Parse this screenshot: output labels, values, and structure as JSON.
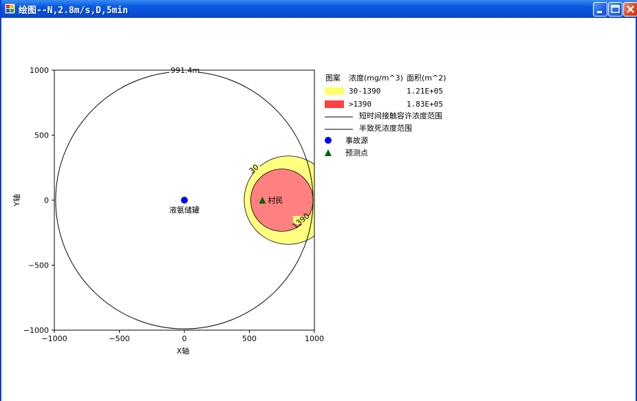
{
  "window": {
    "title": "绘图--N,2.8m/s,D,5min"
  },
  "legend": {
    "header": {
      "pattern": "图案",
      "concentration": "浓度(mg/m^3)",
      "area": "面积(m^2)"
    },
    "rows": [
      {
        "label": "30-1390",
        "area": "1.21E+05",
        "color": "#ffff66"
      },
      {
        "label": ">1390",
        "area": "1.83E+05",
        "color": "#ff4040"
      }
    ],
    "lines": [
      {
        "label": "短时间接触容许浓度范围"
      },
      {
        "label": "半致死浓度范围"
      }
    ],
    "markers": [
      {
        "label": "事故源",
        "color": "#0000ff",
        "shape": "circle"
      },
      {
        "label": "预测点",
        "color": "#006400",
        "shape": "triangle"
      }
    ]
  },
  "chart_data": {
    "type": "scatter",
    "xlabel": "X轴",
    "ylabel": "Y轴",
    "xlim": [
      -1000,
      1000
    ],
    "ylim": [
      -1000,
      1000
    ],
    "xticks": [
      -1000,
      -500,
      0,
      500,
      1000
    ],
    "yticks": [
      1000,
      500,
      0,
      -500,
      -1000
    ],
    "xtick_labels": [
      "−1000",
      "−500",
      "0",
      "500",
      "1000"
    ],
    "ytick_labels": [
      "1000",
      "500",
      "0",
      "−500",
      "−1000"
    ],
    "contours": [
      {
        "level": "30",
        "cx": 800,
        "cy": 0,
        "r": 340,
        "fill": "#ffff80"
      },
      {
        "level": "1390",
        "cx": 750,
        "cy": 0,
        "r": 240,
        "fill": "#ff8080"
      }
    ],
    "range_circle": {
      "cx": 0,
      "cy": 0,
      "r": 990,
      "label": "991.4m"
    },
    "points": [
      {
        "name": "液氨储罐",
        "x": 0,
        "y": 0,
        "marker": "circle",
        "color": "#0000ff"
      },
      {
        "name": "村民",
        "x": 600,
        "y": 0,
        "marker": "triangle",
        "color": "#006400"
      }
    ]
  }
}
